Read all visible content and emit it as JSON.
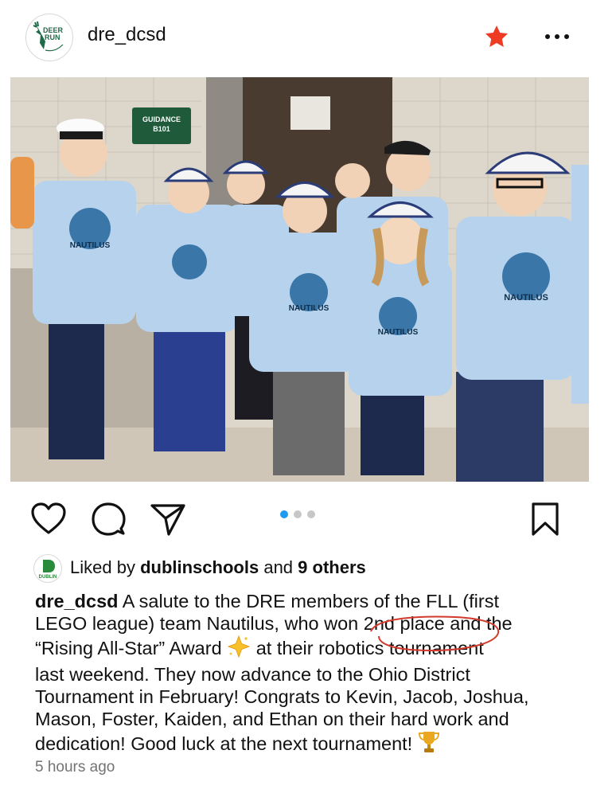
{
  "post": {
    "username": "dre_dcsd",
    "avatar_alt": "Deer Run Elementary logo",
    "avatar_text": [
      "DEER",
      "RUN"
    ],
    "star_icon": "star-icon",
    "more_icon": "more-icon",
    "photo_alt": "Team Nautilus students wearing sailor hats and light blue NAUTILUS shirts",
    "photo_sign": [
      "GUIDANCE",
      "B101"
    ],
    "shirt_text": "NAUTILUS",
    "carousel": {
      "count": 3,
      "active": 0
    },
    "liked_by": {
      "prefix": "Liked by",
      "account": "dublinschools",
      "middle": "and",
      "others": "9 others"
    },
    "liked_avatar_text": "DUBLIN",
    "caption_user": "dre_dcsd",
    "caption_lines": [
      " A salute to the DRE members of the FLL (first",
      "LEGO league) team Nautilus, who won 2nd place and the",
      "“Rising All-Star” Award ",
      " at their robotics tournament",
      "last weekend. They now advance to the Ohio District",
      "Tournament in February! Congrats to Kevin, Jacob, Joshua,",
      "Mason, Foster, Kaiden, and Ethan on their hard work and",
      "dedication! Good luck at the next tournament! "
    ],
    "timestamp": "5 hours ago"
  },
  "colors": {
    "accent_blue": "#1d9bf0",
    "star_red": "#ee3b24",
    "circle_red": "#d33a2c",
    "timestamp_gray": "#737373"
  }
}
